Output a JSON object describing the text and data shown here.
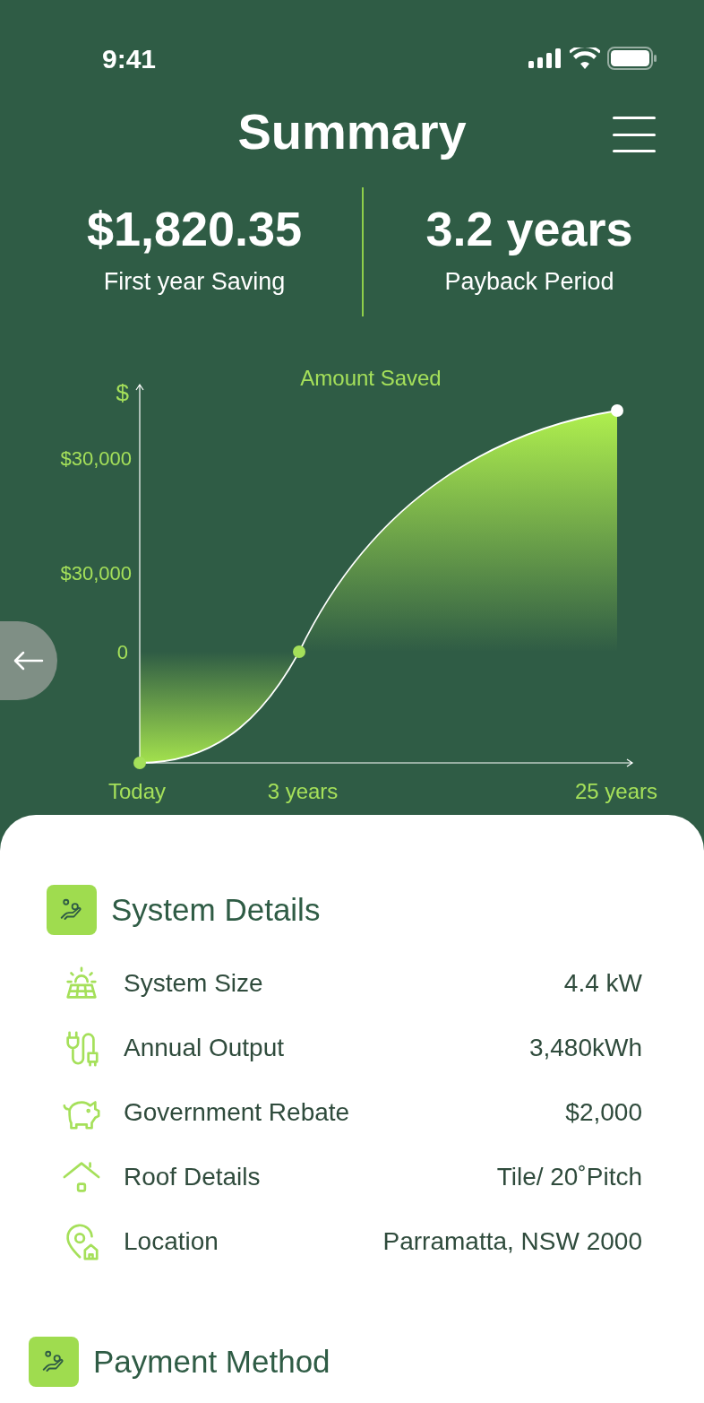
{
  "status_bar": {
    "time": "9:41"
  },
  "header": {
    "title": "Summary"
  },
  "stats": [
    {
      "value": "$1,820.35",
      "label": "First year Saving"
    },
    {
      "value": "3.2 years",
      "label": "Payback Period"
    }
  ],
  "chart": {
    "title": "Amount Saved",
    "y_axis_label": "$",
    "y_labels": [
      "$30,000",
      "$30,000",
      "0"
    ],
    "x_labels": [
      "Today",
      "3 years",
      "25 years"
    ]
  },
  "sections": [
    {
      "title": "System Details",
      "rows": [
        {
          "kind": "solar",
          "label": "System Size",
          "value": "4.4 kW"
        },
        {
          "kind": "plug",
          "label": "Annual Output",
          "value": "3,480kWh"
        },
        {
          "kind": "piggy",
          "label": "Government Rebate",
          "value": "$2,000"
        },
        {
          "kind": "roof",
          "label": "Roof Details",
          "value": "Tile/ 20˚Pitch"
        },
        {
          "kind": "location",
          "label": "Location",
          "value": "Parramatta, NSW 2000"
        }
      ]
    },
    {
      "title": "Payment Method"
    }
  ]
}
